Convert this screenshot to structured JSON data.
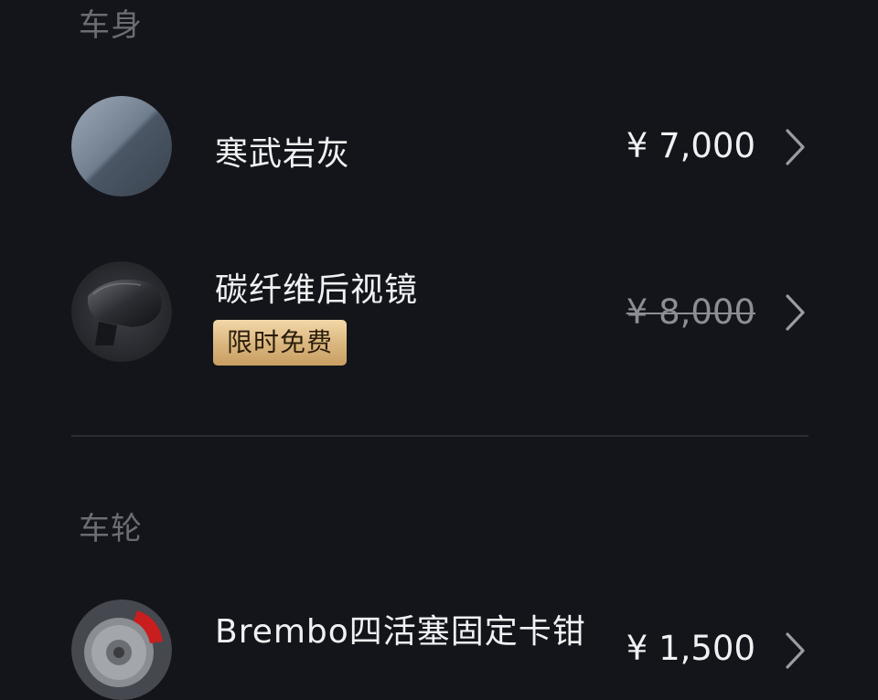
{
  "sections": [
    {
      "title": "车身",
      "items": [
        {
          "name": "寒武岩灰",
          "price": "¥ 7,000",
          "price_struck": false,
          "badge": ""
        },
        {
          "name": "碳纤维后视镜",
          "price": "¥ 8,000",
          "price_struck": true,
          "badge": "限时免费"
        }
      ]
    },
    {
      "title": "车轮",
      "items": [
        {
          "name": "Brembo四活塞固定卡钳",
          "price": "¥ 1,500",
          "price_struck": false,
          "badge": ""
        }
      ]
    }
  ],
  "icons": {
    "chevron": "chevron-right-icon"
  },
  "colors": {
    "background": "#14151a",
    "badge_gold": "#d9b57d",
    "brake_red": "#c81e1e",
    "swatch_grey": "#6f7e8f"
  }
}
